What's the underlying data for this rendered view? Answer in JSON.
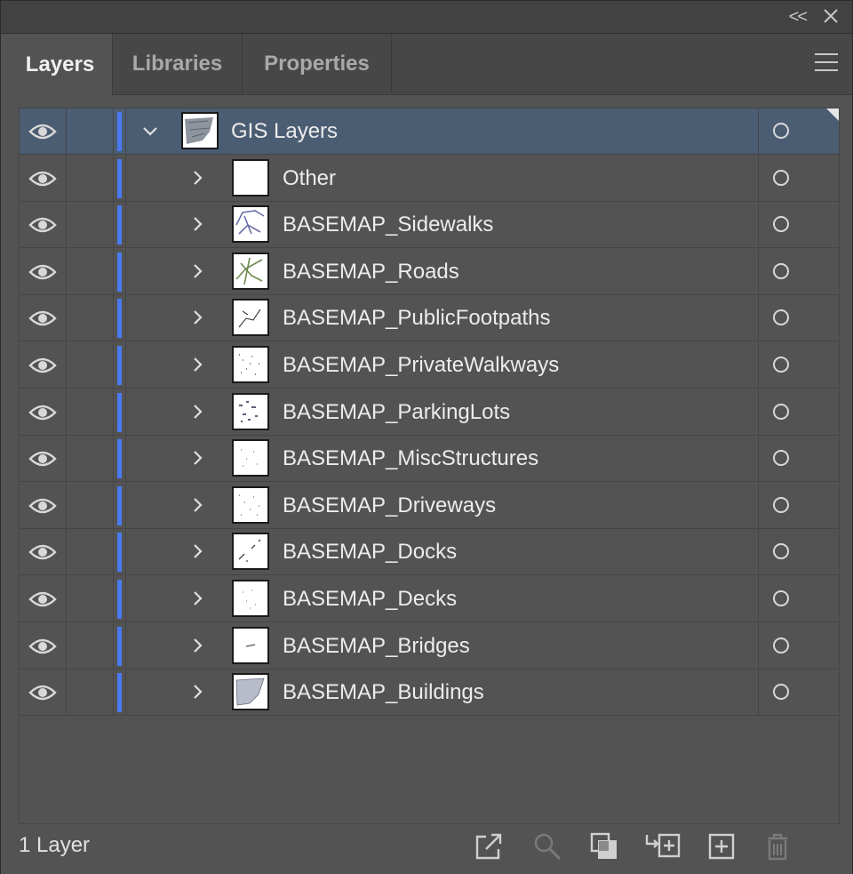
{
  "titlebar": {
    "collapse_label": "<<"
  },
  "tabs": [
    {
      "label": "Layers",
      "active": true
    },
    {
      "label": "Libraries",
      "active": false
    },
    {
      "label": "Properties",
      "active": false
    }
  ],
  "layers": {
    "parent": {
      "name": "GIS Layers",
      "expanded": true,
      "selected": true,
      "visible": true
    },
    "children": [
      {
        "name": "Other",
        "visible": true
      },
      {
        "name": "BASEMAP_Sidewalks",
        "visible": true
      },
      {
        "name": "BASEMAP_Roads",
        "visible": true
      },
      {
        "name": "BASEMAP_PublicFootpaths",
        "visible": true
      },
      {
        "name": "BASEMAP_PrivateWalkways",
        "visible": true
      },
      {
        "name": "BASEMAP_ParkingLots",
        "visible": true
      },
      {
        "name": "BASEMAP_MiscStructures",
        "visible": true
      },
      {
        "name": "BASEMAP_Driveways",
        "visible": true
      },
      {
        "name": "BASEMAP_Docks",
        "visible": true
      },
      {
        "name": "BASEMAP_Decks",
        "visible": true
      },
      {
        "name": "BASEMAP_Bridges",
        "visible": true
      },
      {
        "name": "BASEMAP_Buildings",
        "visible": true
      }
    ],
    "layer_color": "#4a7af2"
  },
  "footer": {
    "count_label": "1 Layer",
    "icons": [
      "export-icon",
      "search-icon",
      "make-clipping-mask-icon",
      "create-sublayer-icon",
      "new-layer-icon",
      "delete-icon"
    ]
  },
  "colors": {
    "panel_bg": "#535353",
    "selected_row": "#4b5d73",
    "text": "#ececec"
  }
}
